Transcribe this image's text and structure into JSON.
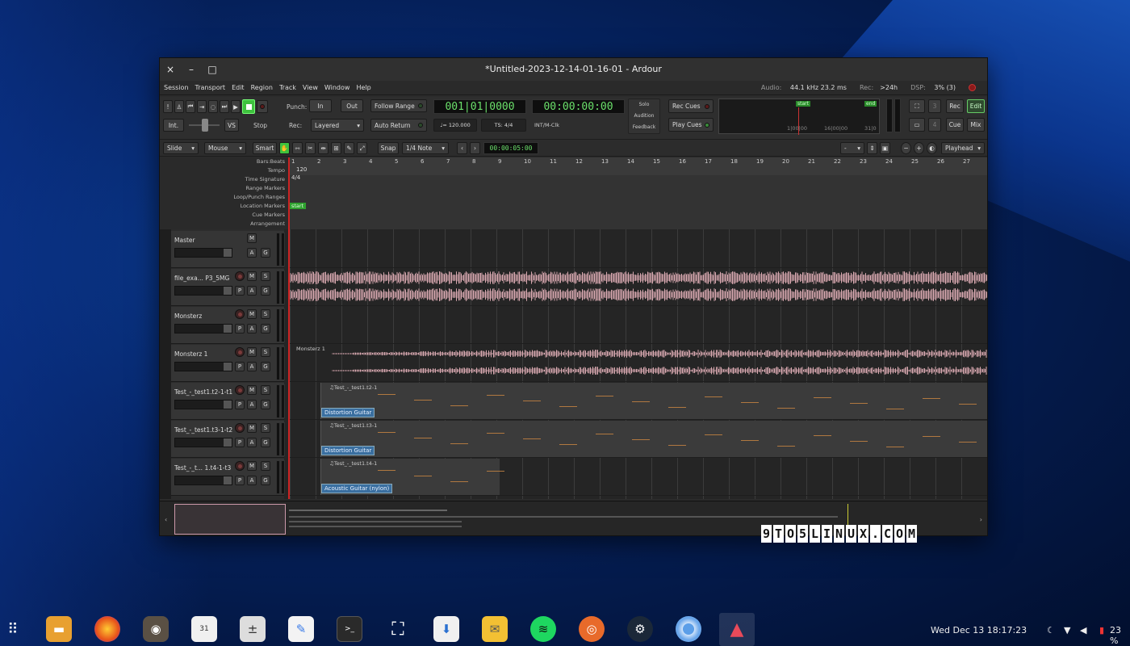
{
  "window": {
    "title": "*Untitled-2023-12-14-01-16-01 - Ardour",
    "close": "×",
    "minimize": "–",
    "maximize": "□"
  },
  "menu": [
    "Session",
    "Transport",
    "Edit",
    "Region",
    "Track",
    "View",
    "Window",
    "Help"
  ],
  "status": {
    "audio_label": "Audio:",
    "audio_value": "44.1 kHz 23.2 ms",
    "rec_label": "Rec:",
    "rec_value": ">24h",
    "dsp_label": "DSP:",
    "dsp_value": "3% (3)"
  },
  "transport": {
    "punch_label": "Punch:",
    "in": "In",
    "out": "Out",
    "follow_range": "Follow Range",
    "auto_return": "Auto Return",
    "rec_label": "Rec:",
    "rec_mode": "Layered",
    "int": "Int.",
    "vs": "VS",
    "stop": "Stop",
    "bbt_clock": "001|01|0000",
    "time_clock": "00:00:00:00",
    "tempo": "♩= 120.000",
    "ts": "TS: 4/4",
    "sync": "INT/M-Clk",
    "solo": "Solo",
    "audition": "Audition",
    "feedback": "Feedback",
    "rec_cues": "Rec Cues",
    "play_cues": "Play Cues",
    "mini_start": "start",
    "mini_end": "end",
    "mini_ticks": [
      "1|00|00",
      "16|00|00",
      "31|0"
    ],
    "cue_3": "3",
    "cue_4": "4",
    "rec_btn": "Rec",
    "edit_btn": "Edit",
    "cue_btn": "Cue",
    "mix_btn": "Mix"
  },
  "edit_toolbar": {
    "edit_mode": "Slide",
    "ripple": "Mouse",
    "smart": "Smart",
    "snap": "Snap",
    "grid": "1/4 Note",
    "nudge_clock": "00:00:05:00",
    "zoom_focus": "Playhead",
    "dash": "-"
  },
  "rulers": [
    "Bars:Beats",
    "Tempo",
    "Time Signature",
    "Range Markers",
    "Loop/Punch Ranges",
    "Location Markers",
    "Cue Markers",
    "Arrangement"
  ],
  "ruler_values": {
    "tempo": "120",
    "ts": "4/4",
    "start": "start"
  },
  "bars": [
    "1",
    "2",
    "3",
    "4",
    "5",
    "6",
    "7",
    "8",
    "9",
    "10",
    "11",
    "12",
    "13",
    "14",
    "15",
    "16",
    "17",
    "18",
    "19",
    "20",
    "21",
    "22",
    "23",
    "24",
    "25",
    "26",
    "27",
    "2"
  ],
  "tracks": [
    {
      "name": "Master",
      "buttons": [
        "M",
        "A",
        "G"
      ],
      "type": "master"
    },
    {
      "name": "file_exa... P3_5MG",
      "buttons": [
        "M",
        "S",
        "P",
        "A",
        "G"
      ],
      "type": "audio"
    },
    {
      "name": "Monsterz",
      "buttons": [
        "M",
        "S",
        "P",
        "A",
        "G"
      ],
      "type": "empty"
    },
    {
      "name": "Monsterz 1",
      "buttons": [
        "M",
        "S",
        "P",
        "A",
        "G"
      ],
      "type": "audio2",
      "region": "Monsterz 1"
    },
    {
      "name": "Test_-_test1.t2-1-t1",
      "buttons": [
        "M",
        "S",
        "P",
        "A",
        "G"
      ],
      "type": "midi",
      "region": "♫Test_-_test1.t2-1",
      "instrument": "Distortion Guitar"
    },
    {
      "name": "Test_-_test1.t3-1-t2",
      "buttons": [
        "M",
        "S",
        "P",
        "A",
        "G"
      ],
      "type": "midi",
      "region": "♫Test_-_test1.t3-1",
      "instrument": "Distortion Guitar"
    },
    {
      "name": "Test_-_t... 1.t4-1-t3",
      "buttons": [
        "M",
        "S",
        "P",
        "A",
        "G"
      ],
      "type": "midi",
      "region": "♫Test_-_test1.t4-1",
      "instrument": "Acoustic Guitar (nylon)"
    }
  ],
  "watermark": [
    "9",
    "T",
    "O",
    "5",
    "L",
    "I",
    "N",
    "U",
    "X",
    ".",
    "C",
    "O",
    "M"
  ],
  "taskbar": {
    "apps": [
      "apps-grid",
      "files",
      "firefox",
      "gimp",
      "calendar",
      "calculator",
      "text-editor",
      "terminal",
      "screenshot",
      "software",
      "mail",
      "spotify",
      "xfburn",
      "steam",
      "chromium",
      "ardour"
    ],
    "calendar_day": "31",
    "terminal_prompt": ">_",
    "clock": "Wed Dec 13  18:17:23",
    "battery": "23 %"
  },
  "colors": {
    "accent_green": "#6be06b",
    "waveform": "#d8a8b0",
    "instrument_blue": "#3a6fa0"
  }
}
